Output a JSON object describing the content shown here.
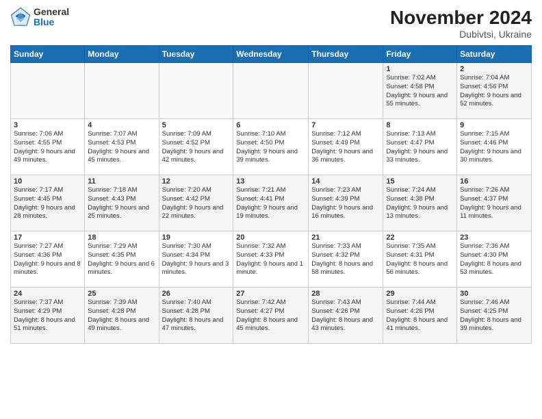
{
  "logo": {
    "general": "General",
    "blue": "Blue"
  },
  "title": "November 2024",
  "location": "Dubivtsi, Ukraine",
  "days_of_week": [
    "Sunday",
    "Monday",
    "Tuesday",
    "Wednesday",
    "Thursday",
    "Friday",
    "Saturday"
  ],
  "weeks": [
    [
      {
        "day": "",
        "info": ""
      },
      {
        "day": "",
        "info": ""
      },
      {
        "day": "",
        "info": ""
      },
      {
        "day": "",
        "info": ""
      },
      {
        "day": "",
        "info": ""
      },
      {
        "day": "1",
        "info": "Sunrise: 7:02 AM\nSunset: 4:58 PM\nDaylight: 9 hours\nand 55 minutes."
      },
      {
        "day": "2",
        "info": "Sunrise: 7:04 AM\nSunset: 4:56 PM\nDaylight: 9 hours\nand 52 minutes."
      }
    ],
    [
      {
        "day": "3",
        "info": "Sunrise: 7:06 AM\nSunset: 4:55 PM\nDaylight: 9 hours\nand 49 minutes."
      },
      {
        "day": "4",
        "info": "Sunrise: 7:07 AM\nSunset: 4:53 PM\nDaylight: 9 hours\nand 45 minutes."
      },
      {
        "day": "5",
        "info": "Sunrise: 7:09 AM\nSunset: 4:52 PM\nDaylight: 9 hours\nand 42 minutes."
      },
      {
        "day": "6",
        "info": "Sunrise: 7:10 AM\nSunset: 4:50 PM\nDaylight: 9 hours\nand 39 minutes."
      },
      {
        "day": "7",
        "info": "Sunrise: 7:12 AM\nSunset: 4:49 PM\nDaylight: 9 hours\nand 36 minutes."
      },
      {
        "day": "8",
        "info": "Sunrise: 7:13 AM\nSunset: 4:47 PM\nDaylight: 9 hours\nand 33 minutes."
      },
      {
        "day": "9",
        "info": "Sunrise: 7:15 AM\nSunset: 4:46 PM\nDaylight: 9 hours\nand 30 minutes."
      }
    ],
    [
      {
        "day": "10",
        "info": "Sunrise: 7:17 AM\nSunset: 4:45 PM\nDaylight: 9 hours\nand 28 minutes."
      },
      {
        "day": "11",
        "info": "Sunrise: 7:18 AM\nSunset: 4:43 PM\nDaylight: 9 hours\nand 25 minutes."
      },
      {
        "day": "12",
        "info": "Sunrise: 7:20 AM\nSunset: 4:42 PM\nDaylight: 9 hours\nand 22 minutes."
      },
      {
        "day": "13",
        "info": "Sunrise: 7:21 AM\nSunset: 4:41 PM\nDaylight: 9 hours\nand 19 minutes."
      },
      {
        "day": "14",
        "info": "Sunrise: 7:23 AM\nSunset: 4:39 PM\nDaylight: 9 hours\nand 16 minutes."
      },
      {
        "day": "15",
        "info": "Sunrise: 7:24 AM\nSunset: 4:38 PM\nDaylight: 9 hours\nand 13 minutes."
      },
      {
        "day": "16",
        "info": "Sunrise: 7:26 AM\nSunset: 4:37 PM\nDaylight: 9 hours\nand 11 minutes."
      }
    ],
    [
      {
        "day": "17",
        "info": "Sunrise: 7:27 AM\nSunset: 4:36 PM\nDaylight: 9 hours\nand 8 minutes."
      },
      {
        "day": "18",
        "info": "Sunrise: 7:29 AM\nSunset: 4:35 PM\nDaylight: 9 hours\nand 6 minutes."
      },
      {
        "day": "19",
        "info": "Sunrise: 7:30 AM\nSunset: 4:34 PM\nDaylight: 9 hours\nand 3 minutes."
      },
      {
        "day": "20",
        "info": "Sunrise: 7:32 AM\nSunset: 4:33 PM\nDaylight: 9 hours\nand 1 minute."
      },
      {
        "day": "21",
        "info": "Sunrise: 7:33 AM\nSunset: 4:32 PM\nDaylight: 8 hours\nand 58 minutes."
      },
      {
        "day": "22",
        "info": "Sunrise: 7:35 AM\nSunset: 4:31 PM\nDaylight: 8 hours\nand 56 minutes."
      },
      {
        "day": "23",
        "info": "Sunrise: 7:36 AM\nSunset: 4:30 PM\nDaylight: 8 hours\nand 53 minutes."
      }
    ],
    [
      {
        "day": "24",
        "info": "Sunrise: 7:37 AM\nSunset: 4:29 PM\nDaylight: 8 hours\nand 51 minutes."
      },
      {
        "day": "25",
        "info": "Sunrise: 7:39 AM\nSunset: 4:28 PM\nDaylight: 8 hours\nand 49 minutes."
      },
      {
        "day": "26",
        "info": "Sunrise: 7:40 AM\nSunset: 4:28 PM\nDaylight: 8 hours\nand 47 minutes."
      },
      {
        "day": "27",
        "info": "Sunrise: 7:42 AM\nSunset: 4:27 PM\nDaylight: 8 hours\nand 45 minutes."
      },
      {
        "day": "28",
        "info": "Sunrise: 7:43 AM\nSunset: 4:26 PM\nDaylight: 8 hours\nand 43 minutes."
      },
      {
        "day": "29",
        "info": "Sunrise: 7:44 AM\nSunset: 4:26 PM\nDaylight: 8 hours\nand 41 minutes."
      },
      {
        "day": "30",
        "info": "Sunrise: 7:46 AM\nSunset: 4:25 PM\nDaylight: 8 hours\nand 39 minutes."
      }
    ]
  ]
}
